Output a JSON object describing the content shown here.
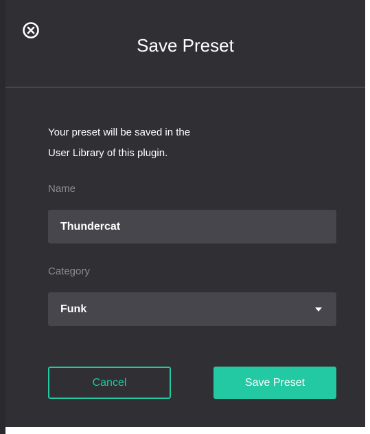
{
  "dialog": {
    "title": "Save Preset",
    "close_icon": "close-circle-icon",
    "description_line1": "Your preset will be saved in the",
    "description_line2": "User Library of this plugin.",
    "name_label": "Name",
    "name_value": "Thundercat",
    "category_label": "Category",
    "category_value": "Funk",
    "dropdown_icon": "caret-down-icon",
    "cancel_label": "Cancel",
    "save_label": "Save Preset"
  },
  "colors": {
    "background": "#2f2f34",
    "field": "#46464c",
    "accent": "#22c9a2",
    "label": "#8b8b91"
  }
}
